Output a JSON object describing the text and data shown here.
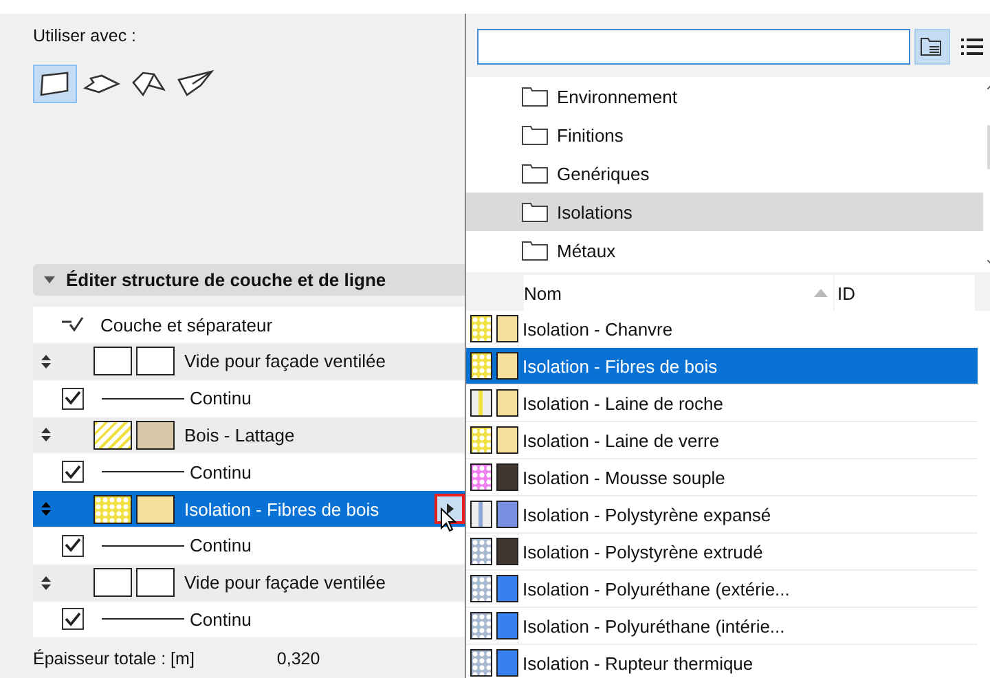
{
  "use_with": {
    "label": "Utiliser avec :",
    "tools": [
      {
        "kind": "wall",
        "selected": true
      },
      {
        "kind": "slab",
        "selected": false
      },
      {
        "kind": "roof",
        "selected": false
      },
      {
        "kind": "shell",
        "selected": false
      }
    ]
  },
  "structure": {
    "title": "Éditer structure de couche et de ligne",
    "expanded": true,
    "rows": [
      {
        "kind": "header",
        "label": "Couche et séparateur"
      },
      {
        "kind": "layer",
        "name": "Vide pour façade ventilée",
        "swatches": [
          {
            "kind": "solid",
            "color": "#ffffff"
          },
          {
            "kind": "solid",
            "color": "#ffffff"
          }
        ],
        "selected": false
      },
      {
        "kind": "line",
        "label": "Continu",
        "checked": true
      },
      {
        "kind": "layer",
        "name": "Bois - Lattage",
        "swatches": [
          {
            "kind": "hatch",
            "color": "#f0e040"
          },
          {
            "kind": "solid",
            "color": "#d8c8a8"
          }
        ],
        "selected": false
      },
      {
        "kind": "line",
        "label": "Continu",
        "checked": true
      },
      {
        "kind": "layer",
        "name": "Isolation - Fibres de bois",
        "swatches": [
          {
            "kind": "dots",
            "color": "#f0e040"
          },
          {
            "kind": "solid",
            "color": "#f5df9a"
          }
        ],
        "selected": true
      },
      {
        "kind": "line",
        "label": "Continu",
        "checked": true
      },
      {
        "kind": "layer",
        "name": "Vide pour façade ventilée",
        "swatches": [
          {
            "kind": "solid",
            "color": "#ffffff"
          },
          {
            "kind": "solid",
            "color": "#ffffff"
          }
        ],
        "selected": false
      },
      {
        "kind": "line",
        "label": "Continu",
        "checked": true
      }
    ],
    "total_label": "Épaisseur totale : [m]",
    "total_value": "0,320"
  },
  "picker": {
    "folders": [
      {
        "name": "Environnement",
        "selected": false
      },
      {
        "name": "Finitions",
        "selected": false
      },
      {
        "name": "Genériques",
        "selected": false
      },
      {
        "name": "Isolations",
        "selected": true
      },
      {
        "name": "Métaux",
        "selected": false
      }
    ],
    "columns": [
      "Nom",
      "ID"
    ],
    "rows": [
      {
        "name": "Isolation - Chanvre",
        "swatches": [
          {
            "kind": "dots",
            "color": "#f0e040"
          },
          {
            "kind": "solid",
            "color": "#f5df9a"
          }
        ],
        "selected": false
      },
      {
        "name": "Isolation - Fibres de bois",
        "swatches": [
          {
            "kind": "dots",
            "color": "#f0e040"
          },
          {
            "kind": "solid",
            "color": "#f5df9a"
          }
        ],
        "selected": true
      },
      {
        "name": "Isolation - Laine de roche",
        "swatches": [
          {
            "kind": "lines",
            "color": "#f0e040"
          },
          {
            "kind": "solid",
            "color": "#f5df9a"
          }
        ],
        "selected": false
      },
      {
        "name": "Isolation - Laine de verre",
        "swatches": [
          {
            "kind": "dots",
            "color": "#f0e040"
          },
          {
            "kind": "solid",
            "color": "#f5df9a"
          }
        ],
        "selected": false
      },
      {
        "name": "Isolation - Mousse souple",
        "swatches": [
          {
            "kind": "dots",
            "color": "#f080f0"
          },
          {
            "kind": "solid",
            "color": "#403530"
          }
        ],
        "selected": false
      },
      {
        "name": "Isolation - Polystyrène expansé",
        "swatches": [
          {
            "kind": "lines",
            "color": "#90a8d8"
          },
          {
            "kind": "solid",
            "color": "#7890e0"
          }
        ],
        "selected": false
      },
      {
        "name": "Isolation - Polystyrène extrudé",
        "swatches": [
          {
            "kind": "dots",
            "color": "#a8b8d0"
          },
          {
            "kind": "solid",
            "color": "#403530"
          }
        ],
        "selected": false
      },
      {
        "name": "Isolation - Polyuréthane (extérie...",
        "swatches": [
          {
            "kind": "dots",
            "color": "#a8b8d0"
          },
          {
            "kind": "solid",
            "color": "#3880f0"
          }
        ],
        "selected": false
      },
      {
        "name": "Isolation - Polyuréthane (intérie...",
        "swatches": [
          {
            "kind": "dots",
            "color": "#a8b8d0"
          },
          {
            "kind": "solid",
            "color": "#3880f0"
          }
        ],
        "selected": false
      },
      {
        "name": "Isolation - Rupteur thermique",
        "swatches": [
          {
            "kind": "dots",
            "color": "#a8b8d0"
          },
          {
            "kind": "solid",
            "color": "#3880f0"
          }
        ],
        "selected": false
      }
    ]
  }
}
